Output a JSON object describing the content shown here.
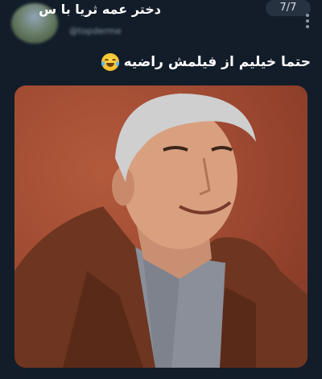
{
  "post": {
    "display_name": "دختر عمه ثریا با س",
    "handle": "@topderme",
    "image_counter": "7/7",
    "text": "حتما خیلیم از فیلمش راضیه"
  },
  "icons": {
    "more": "more-vertical-icon",
    "emoji": "face-with-tears-of-joy-icon"
  },
  "colors": {
    "background": "#131d2a",
    "text": "#ffffff",
    "muted": "#8d99a8",
    "photo_wall": "#9a4630",
    "jacket": "#6e3520"
  }
}
